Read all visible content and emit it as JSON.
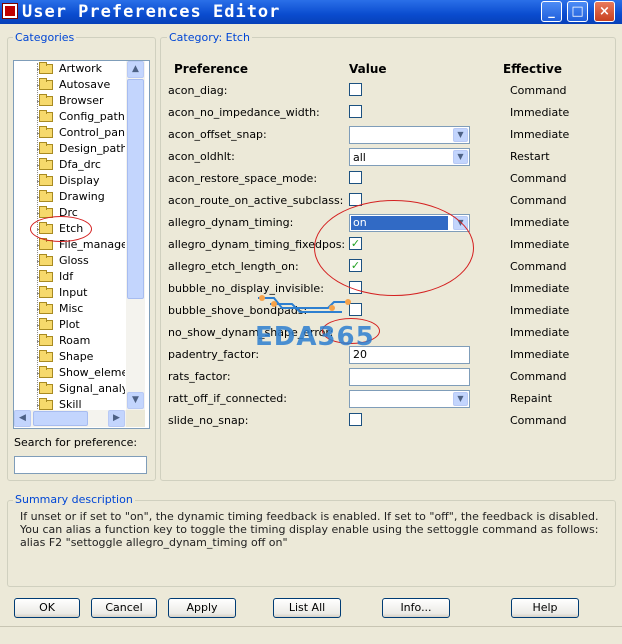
{
  "window": {
    "title": "User Preferences Editor",
    "controls": {
      "minimize": "_",
      "maximize": "□",
      "close": "×"
    }
  },
  "categories": {
    "legend": "Categories",
    "items": [
      "Artwork",
      "Autosave",
      "Browser",
      "Config_paths",
      "Control_panel",
      "Design_paths",
      "Dfa_drc",
      "Display",
      "Drawing",
      "Drc",
      "Etch",
      "File_managem",
      "Gloss",
      "Idf",
      "Input",
      "Misc",
      "Plot",
      "Roam",
      "Shape",
      "Show_elemen",
      "Signal_analys",
      "Skill"
    ],
    "selected": "Etch",
    "search_label": "Search for preference:",
    "search_value": ""
  },
  "prefs": {
    "legend": "Category:  Etch",
    "headers": {
      "preference": "Preference",
      "value": "Value",
      "effective": "Effective"
    },
    "rows": [
      {
        "name": "acon_diag:",
        "type": "checkbox",
        "checked": false,
        "effective": "Command"
      },
      {
        "name": "acon_no_impedance_width:",
        "type": "checkbox",
        "checked": false,
        "effective": "Immediate"
      },
      {
        "name": "acon_offset_snap:",
        "type": "combo",
        "value": "",
        "effective": "Immediate"
      },
      {
        "name": "acon_oldhlt:",
        "type": "combo",
        "value": "all",
        "effective": "Restart"
      },
      {
        "name": "acon_restore_space_mode:",
        "type": "checkbox",
        "checked": false,
        "effective": "Command"
      },
      {
        "name": "acon_route_on_active_subclass:",
        "type": "checkbox",
        "checked": false,
        "effective": "Command"
      },
      {
        "name": "allegro_dynam_timing:",
        "type": "combo",
        "value": "on",
        "selected": true,
        "effective": "Immediate"
      },
      {
        "name": "allegro_dynam_timing_fixedpos:",
        "type": "checkbox",
        "checked": true,
        "effective": "Immediate"
      },
      {
        "name": "allegro_etch_length_on:",
        "type": "checkbox",
        "checked": true,
        "effective": "Command"
      },
      {
        "name": "bubble_no_display_invisible:",
        "type": "checkbox",
        "checked": false,
        "effective": "Immediate"
      },
      {
        "name": "bubble_shove_bondpads:",
        "type": "checkbox",
        "checked": false,
        "effective": "Immediate"
      },
      {
        "name": "no_show_dynam_shape_error:",
        "type": "none",
        "effective": "Immediate"
      },
      {
        "name": "padentry_factor:",
        "type": "text",
        "value": "20",
        "effective": "Immediate"
      },
      {
        "name": "rats_factor:",
        "type": "text",
        "value": "",
        "effective": "Command"
      },
      {
        "name": "ratt_off_if_connected:",
        "type": "combo",
        "value": "",
        "effective": "Repaint"
      },
      {
        "name": "slide_no_snap:",
        "type": "checkbox",
        "checked": false,
        "effective": "Command"
      }
    ]
  },
  "summary": {
    "legend": "Summary description",
    "text": "If unset or if set to \"on\",  the dynamic timing feedback is enabled.  If set to \"off\",  the feedback is disabled.  You can alias a function key to toggle the timing display enable using the settoggle command as follows: alias F2 \"settoggle allegro_dynam_timing off on\""
  },
  "buttons": {
    "ok": "OK",
    "cancel": "Cancel",
    "apply": "Apply",
    "list_all": "List All",
    "info": "Info...",
    "help": "Help"
  },
  "watermark": "EDA365",
  "colors": {
    "title_blue": "#0a4ccf",
    "legend_blue": "#0046d5",
    "selection": "#316ac5",
    "annotation_red": "#d42020",
    "check_green": "#21a121"
  }
}
